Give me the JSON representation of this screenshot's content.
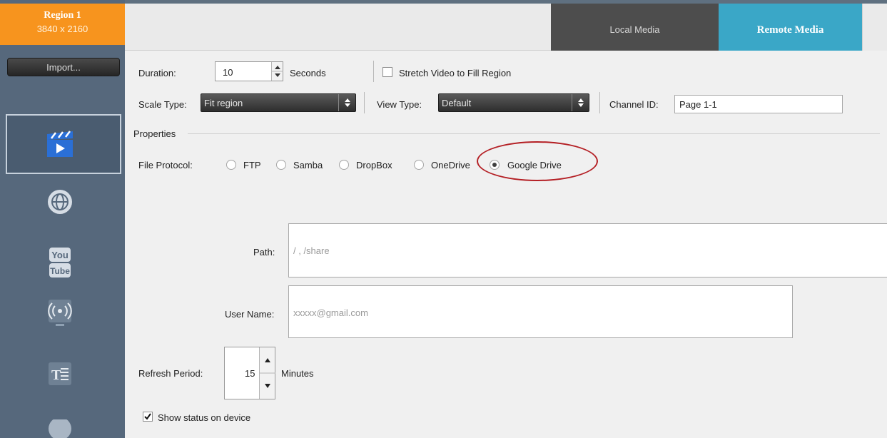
{
  "sidebar": {
    "region_title": "Region 1",
    "region_size": "3840 x 2160",
    "import_label": "Import...",
    "icons": [
      "video-clapper-icon",
      "globe-icon",
      "youtube-icon",
      "broadcast-icon",
      "text-icon",
      "more-icon"
    ]
  },
  "tabs": {
    "local": "Local Media",
    "remote": "Remote Media"
  },
  "form": {
    "duration_label": "Duration:",
    "duration_value": "10",
    "duration_unit": "Seconds",
    "stretch_label": "Stretch Video to Fill Region",
    "stretch_checked": false,
    "scale_type_label": "Scale Type:",
    "scale_type_value": "Fit region",
    "view_type_label": "View Type:",
    "view_type_value": "Default",
    "channel_id_label": "Channel ID:",
    "channel_id_value": "Page 1-1",
    "properties_label": "Properties",
    "file_protocol_label": "File Protocol:",
    "protocols": [
      "FTP",
      "Samba",
      "DropBox",
      "OneDrive",
      "Google Drive"
    ],
    "selected_protocol": "Google Drive",
    "path_label": "Path:",
    "path_placeholder": "/ , /share",
    "username_label": "User Name:",
    "username_placeholder": "xxxxx@gmail.com",
    "refresh_label": "Refresh Period:",
    "refresh_value": "15",
    "refresh_unit": "Minutes",
    "show_status_label": "Show status on device",
    "show_status_checked": true
  },
  "colors": {
    "region_orange": "#f7941e",
    "remote_tab_blue": "#3aa7c7",
    "sidebar_slate": "#56687c",
    "highlight_circle": "#b41f24"
  }
}
